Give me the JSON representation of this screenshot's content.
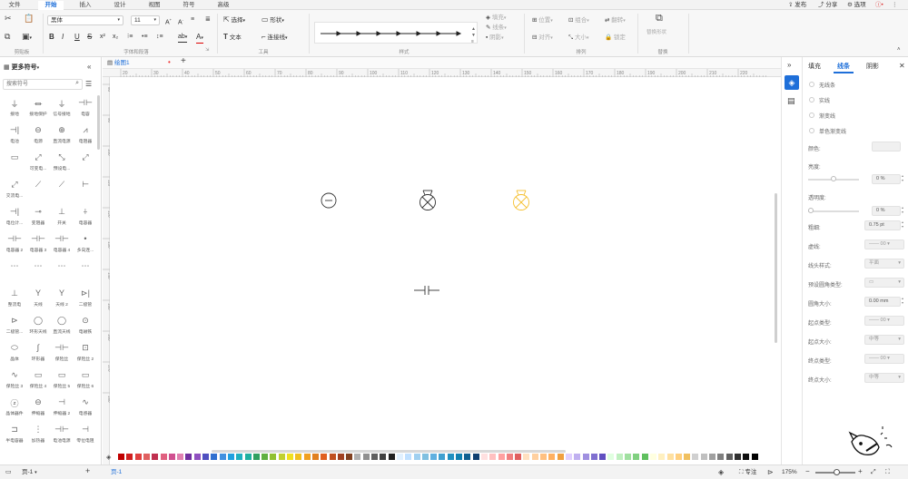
{
  "tabs": {
    "file": "文件",
    "home": "开始",
    "insert": "插入",
    "design": "设计",
    "view": "视图",
    "symbol": "符号",
    "advanced": "高级"
  },
  "topright": {
    "publish": "发布",
    "share": "分享",
    "options": "选项"
  },
  "ribbon": {
    "clipboard_label": "剪贴板",
    "font_name": "黑体",
    "font_size": "11",
    "font_group_label": "字体和段落",
    "select_label": "选择",
    "shape_label": "形状",
    "text_label": "文本",
    "connector_label": "连接线",
    "tools_label": "工具",
    "style_label": "样式",
    "fill_label": "填充",
    "line_label": "线条",
    "shadow_label": "阴影",
    "position_label": "位置",
    "group_label": "组合",
    "rotate_label": "翻转",
    "align_label": "对齐",
    "size_label": "大小",
    "lock_label": "锁定",
    "arrange_label": "排列",
    "replace_shape_label": "替换形状",
    "replace_label": "替换"
  },
  "left_panel": {
    "title": "更多符号",
    "search_placeholder": "搜索符号",
    "symbols": [
      [
        "接地",
        "接地保护",
        "信号接地",
        "电容"
      ],
      [
        "电池",
        "电源",
        "直流电源",
        "电阻器"
      ],
      [
        "",
        "可变电...",
        "预设电...",
        ""
      ],
      [
        "交流电...",
        "",
        "",
        ""
      ],
      [
        "电位计...",
        "变阻器",
        "开关",
        "电容器"
      ],
      [
        "电容器 2",
        "电容器 3",
        "电容器 4",
        "多向连..."
      ],
      [
        "",
        "",
        "",
        ""
      ],
      [
        "整流电",
        "天线",
        "天线 2",
        "二极管"
      ],
      [
        "二极管...",
        "环形天线",
        "直流天线",
        "电磁铁"
      ],
      [
        "晶体",
        "环形器",
        "保险丝",
        "保险丝 2"
      ],
      [
        "保险丝 3",
        "保险丝 4",
        "保险丝 5",
        "保险丝 6"
      ],
      [
        "晶体器件",
        "伸缩器",
        "伸缩器 2",
        "电感器"
      ],
      [
        "半电容器",
        "加热器",
        "电池电源",
        "零位电阻"
      ]
    ]
  },
  "doc_tab": {
    "name": "绘图1"
  },
  "ruler_top": [
    "20",
    "30",
    "40",
    "50",
    "60",
    "70",
    "80",
    "90",
    "100",
    "110",
    "120",
    "130",
    "140",
    "150",
    "160",
    "170",
    "180",
    "190",
    "200",
    "210",
    "220"
  ],
  "ruler_left": [
    "80",
    "90",
    "100",
    "110",
    "120",
    "130",
    "140",
    "150",
    "160",
    "170",
    "180"
  ],
  "right_panel": {
    "tabs": {
      "fill": "填充",
      "line": "线条",
      "shadow": "阴影"
    },
    "line_types": [
      "无线条",
      "实线",
      "渐变线",
      "单色渐变线"
    ],
    "color_label": "颜色:",
    "brightness_label": "亮度:",
    "brightness_value": "0 %",
    "transparency_label": "透明度:",
    "transparency_value": "0 %",
    "width_label": "粗细:",
    "width_value": "0.75 pt",
    "dash_label": "虚线:",
    "dash_value": "00",
    "cap_label": "线头样式:",
    "cap_value": "平面",
    "corner_type_label": "预设圆角类型:",
    "corner_size_label": "圆角大小:",
    "corner_size_value": "0.00 mm",
    "start_type_label": "起点类型:",
    "start_type_value": "00",
    "start_size_label": "起点大小:",
    "start_size_value": "中等",
    "end_type_label": "终点类型:",
    "end_type_value": "00",
    "end_size_label": "终点大小:",
    "end_size_value": "中等"
  },
  "status": {
    "page_select": "页-1",
    "page_tab": "页-1",
    "focus": "专注",
    "zoom": "175%"
  },
  "colors": {
    "accent": "#1e6fd9",
    "bulb_yellow": "#f5c030",
    "palette": [
      "#c00000",
      "#d02020",
      "#e04040",
      "#e06060",
      "#c03050",
      "#e06080",
      "#d05090",
      "#e080b0",
      "#7030a0",
      "#9050c0",
      "#5050c0",
      "#3070d0",
      "#4090e0",
      "#20a0e0",
      "#20b0c0",
      "#20b0a0",
      "#30a060",
      "#60b040",
      "#90c030",
      "#c0d030",
      "#f0e020",
      "#f0c020",
      "#f0a020",
      "#e08020",
      "#e06020",
      "#c05020",
      "#a04020",
      "#804020",
      "#b0b0b0",
      "#909090",
      "#606060",
      "#404040",
      "#202020",
      "#e0f0ff",
      "#c0e0ff",
      "#a0d0f0",
      "#80c0e0",
      "#60b0e0",
      "#40a0d0",
      "#2090c0",
      "#1080b0",
      "#106090",
      "#104070",
      "#ffe0e0",
      "#ffc0c0",
      "#ffa0a0",
      "#f08080",
      "#e06060",
      "#ffe0c0",
      "#ffd0a0",
      "#ffc080",
      "#ffb060",
      "#f0a040",
      "#e0d0ff",
      "#c0b0f0",
      "#a090e0",
      "#8070d0",
      "#6050c0",
      "#e0ffe0",
      "#c0f0c0",
      "#a0e0a0",
      "#80d080",
      "#60c060",
      "#ffffe0",
      "#fff0c0",
      "#ffe0a0",
      "#ffd080",
      "#f0c060",
      "#d0d0d0",
      "#c0c0c0",
      "#a0a0a0",
      "#808080",
      "#606060",
      "#303030",
      "#101010",
      "#000000"
    ]
  }
}
